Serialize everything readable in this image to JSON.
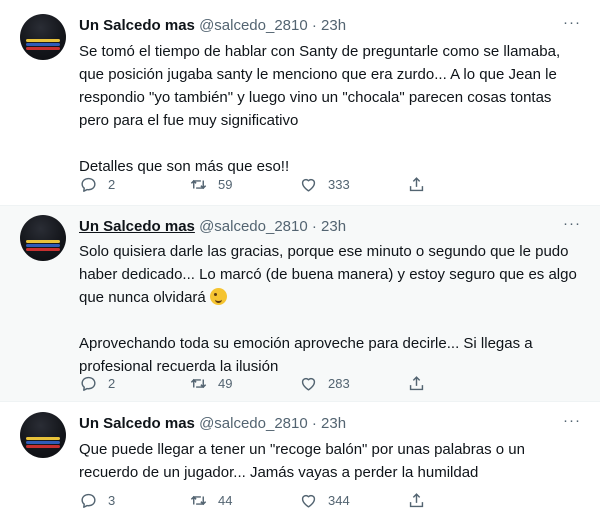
{
  "colors": {
    "text": "#0f1419",
    "secondary": "#536471",
    "divider": "#eff3f4",
    "hover_bg": "#f7f9f9"
  },
  "tweets": [
    {
      "name": "Un Salcedo mas",
      "handle": "@salcedo_2810",
      "separator": "·",
      "time": "23h",
      "paragraphs": [
        "Se tomó el tiempo de hablar con Santy de preguntarle como se llamaba, que posición jugaba santy le menciono que era zurdo... A lo que Jean le respondio \"yo también\" y luego vino un \"chocala\" parecen cosas tontas pero para el fue muy significativo",
        "Detalles que son más que eso!!"
      ],
      "replies": "2",
      "retweets": "59",
      "likes": "333"
    },
    {
      "name": "Un Salcedo mas",
      "handle": "@salcedo_2810",
      "separator": "·",
      "time": "23h",
      "paragraphs": [
        "Solo quisiera darle las gracias, porque ese minuto o segundo que le pudo haber dedicado... Lo marcó (de buena manera) y estoy seguro que es algo que nunca olvidará",
        "Aprovechando toda su emoción aproveche para decirle... Si llegas a profesional recuerda la ilusión"
      ],
      "emoji": "winking-face-emoji",
      "replies": "2",
      "retweets": "49",
      "likes": "283"
    },
    {
      "name": "Un Salcedo mas",
      "handle": "@salcedo_2810",
      "separator": "·",
      "time": "23h",
      "paragraphs": [
        "Que puede llegar a tener un \"recoge balón\" por unas palabras o un recuerdo de un jugador... Jamás vayas a perder la humildad"
      ],
      "replies": "3",
      "retweets": "44",
      "likes": "344"
    }
  ],
  "icons": {
    "more": "more-horizontal-icon",
    "reply": "reply-icon",
    "retweet": "retweet-icon",
    "like": "heart-icon",
    "share": "share-icon"
  },
  "more_glyph": "···"
}
